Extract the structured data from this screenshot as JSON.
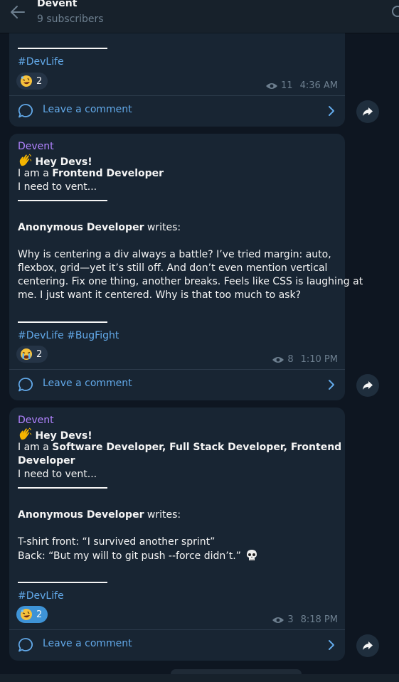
{
  "header": {
    "title": "Devent",
    "subtitle": "9 subscribers"
  },
  "colors": {
    "background": "#0e1621",
    "bubble": "#182533",
    "accent": "#62a9e9",
    "sender": "#b183ff"
  },
  "posts": [
    {
      "hashtags": "#DevLife",
      "reaction": {
        "emoji": "rofl-face-icon",
        "count": "2"
      },
      "views": "11",
      "time": "4:36 AM",
      "comment_label": "Leave a comment"
    },
    {
      "sender": "Devent",
      "greeting": "Hey Devs!",
      "intro_prefix": "I am a ",
      "role": "Frontend Developer",
      "vent": "I need to vent...",
      "author": "Anonymous Developer",
      "writes": " writes:",
      "body_lines": [
        "Why is centering a div always a battle? I’ve tried margin: auto,",
        "flexbox, grid—yet it’s still off. And don’t even mention vertical",
        "centering. Fix one thing, another breaks. Feels like CSS is laughing at",
        "me. I just want it centered. Why is that too much to ask?"
      ],
      "hashtags": "#DevLife #BugFight",
      "reaction": {
        "emoji": "crying-face-icon",
        "count": "2"
      },
      "views": "8",
      "time": "1:10 PM",
      "comment_label": "Leave a comment"
    },
    {
      "sender": "Devent",
      "greeting": "Hey Devs!",
      "intro_prefix": "I am a ",
      "role_line1": "Software Developer, Full Stack Developer, Frontend",
      "role_line2": "Developer",
      "vent": "I need to vent...",
      "author": "Anonymous Developer",
      "writes": " writes:",
      "body_lines": [
        "T-shirt front: “I survived another sprint”",
        "Back: “But my will to git push --force didn’t.”"
      ],
      "hashtags": "#DevLife",
      "reaction": {
        "emoji": "rofl-face-icon",
        "count": "2"
      },
      "views": "3",
      "time": "8:18 PM",
      "comment_label": "Leave a comment"
    }
  ]
}
